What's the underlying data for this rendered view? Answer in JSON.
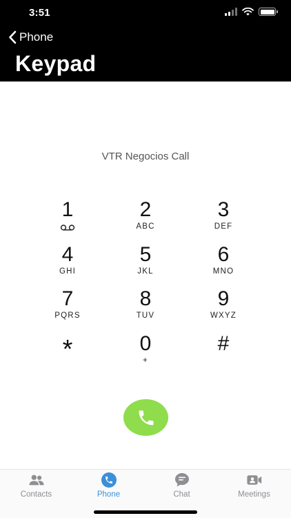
{
  "status": {
    "time": "3:51"
  },
  "nav": {
    "back_label": "Phone",
    "title": "Keypad"
  },
  "dialer": {
    "call_label": "VTR Negocios Call",
    "keys": [
      {
        "digit": "1",
        "letters": "",
        "icon": "voicemail-icon"
      },
      {
        "digit": "2",
        "letters": "ABC"
      },
      {
        "digit": "3",
        "letters": "DEF"
      },
      {
        "digit": "4",
        "letters": "GHI"
      },
      {
        "digit": "5",
        "letters": "JKL"
      },
      {
        "digit": "6",
        "letters": "MNO"
      },
      {
        "digit": "7",
        "letters": "PQRS"
      },
      {
        "digit": "8",
        "letters": "TUV"
      },
      {
        "digit": "9",
        "letters": "WXYZ"
      },
      {
        "digit": "*",
        "letters": ""
      },
      {
        "digit": "0",
        "letters": "+"
      },
      {
        "digit": "#",
        "letters": ""
      }
    ],
    "call_button_icon": "phone-icon"
  },
  "tabs": [
    {
      "label": "Contacts",
      "icon": "contacts-icon",
      "active": false
    },
    {
      "label": "Phone",
      "icon": "phone-icon",
      "active": true
    },
    {
      "label": "Chat",
      "icon": "chat-icon",
      "active": false
    },
    {
      "label": "Meetings",
      "icon": "video-camera-icon",
      "active": false
    }
  ],
  "colors": {
    "header_bg": "#000000",
    "call_green": "#8fdc4d",
    "active_tab": "#3d8fd8",
    "inactive_tab": "#8e8e93"
  }
}
